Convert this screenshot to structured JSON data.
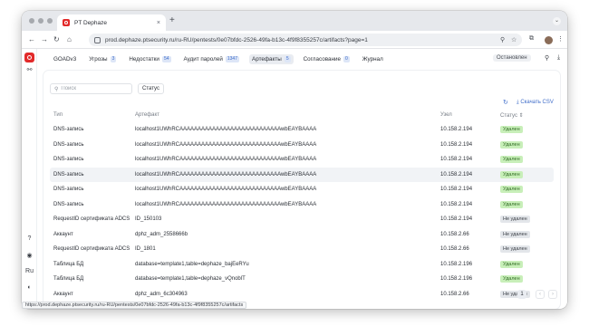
{
  "browser": {
    "tab_title": "PT Dephaze",
    "tab_close": "×",
    "new_tab": "+",
    "url": "prod.dephaze.ptsecurity.ru/ru-RU/pentests/0e07bfdc-2526-49fa-b13c-4f9f8355257c/artifacts?page=1",
    "status_url": "https://prod.dephaze.ptsecurity.ru/ru-RU/pentests/0e07bfdc-2526-49fa-b13c-4f9f8355257c/artifacts"
  },
  "sidebar": {
    "lang": "Ru",
    "help": "?"
  },
  "nav": {
    "tabs": [
      {
        "label": "GOADv3",
        "count": ""
      },
      {
        "label": "Угрозы",
        "count": "3"
      },
      {
        "label": "Недостатки",
        "count": "54"
      },
      {
        "label": "Аудит паролей",
        "count": "1347"
      },
      {
        "label": "Артефакты",
        "count": "5"
      },
      {
        "label": "Согласование",
        "count": "0"
      },
      {
        "label": "Журнал",
        "count": ""
      }
    ],
    "stop_label": "Остановлен"
  },
  "filters": {
    "search_placeholder": "Поиск",
    "status_label": "Статус"
  },
  "actions": {
    "csv_label": "Скачать CSV"
  },
  "table": {
    "headers": {
      "type": "Тип",
      "artifact": "Артефакт",
      "node": "Узел",
      "status": "Статус"
    },
    "rows": [
      {
        "type": "DNS-запись",
        "artifact": "localhost1UWhRCAAAAAAAAAAAAAAAAAAAAAAAAAAAAwbEAYBAAAA",
        "node": "10.158.2.194",
        "status": "Удален",
        "ok": true
      },
      {
        "type": "DNS-запись",
        "artifact": "localhost1UWhRCAAAAAAAAAAAAAAAAAAAAAAAAAAAAwbEAYBAAAA",
        "node": "10.158.2.194",
        "status": "Удален",
        "ok": true
      },
      {
        "type": "DNS-запись",
        "artifact": "localhost1UWhRCAAAAAAAAAAAAAAAAAAAAAAAAAAAAwbEAYBAAAA",
        "node": "10.158.2.194",
        "status": "Удален",
        "ok": true
      },
      {
        "type": "DNS-запись",
        "artifact": "localhost1UWhRCAAAAAAAAAAAAAAAAAAAAAAAAAAAAwbEAYBAAAA",
        "node": "10.158.2.194",
        "status": "Удален",
        "ok": true
      },
      {
        "type": "DNS-запись",
        "artifact": "localhost1UWhRCAAAAAAAAAAAAAAAAAAAAAAAAAAAAwbEAYBAAAA",
        "node": "10.158.2.194",
        "status": "Удален",
        "ok": true
      },
      {
        "type": "DNS-запись",
        "artifact": "localhost1UWhRCAAAAAAAAAAAAAAAAAAAAAAAAAAAAwbEAYBAAAA",
        "node": "10.158.2.194",
        "status": "Удален",
        "ok": true
      },
      {
        "type": "RequestID сертификата ADCS",
        "artifact": "ID_150103",
        "node": "10.158.2.194",
        "status": "Не удален",
        "ok": false
      },
      {
        "type": "Аккаунт",
        "artifact": "dphz_adm_2558666b",
        "node": "10.158.2.66",
        "status": "Не удален",
        "ok": false
      },
      {
        "type": "RequestID сертификата ADCS",
        "artifact": "ID_1801",
        "node": "10.158.2.66",
        "status": "Не удален",
        "ok": false
      },
      {
        "type": "Таблица БД",
        "artifact": "database=template1,table=dephaze_bajEeRYu",
        "node": "10.158.2.196",
        "status": "Удален",
        "ok": true
      },
      {
        "type": "Таблица БД",
        "artifact": "database=template1,table=dephaze_vQnoblT",
        "node": "10.158.2.196",
        "status": "Удален",
        "ok": true
      },
      {
        "type": "Аккаунт",
        "artifact": "dphz_adm_6c304963",
        "node": "10.158.2.66",
        "status": "Не удален",
        "ok": false
      }
    ],
    "highlight_row": 3
  },
  "pagination": {
    "page": "1",
    "prev": "‹",
    "next": "›"
  }
}
